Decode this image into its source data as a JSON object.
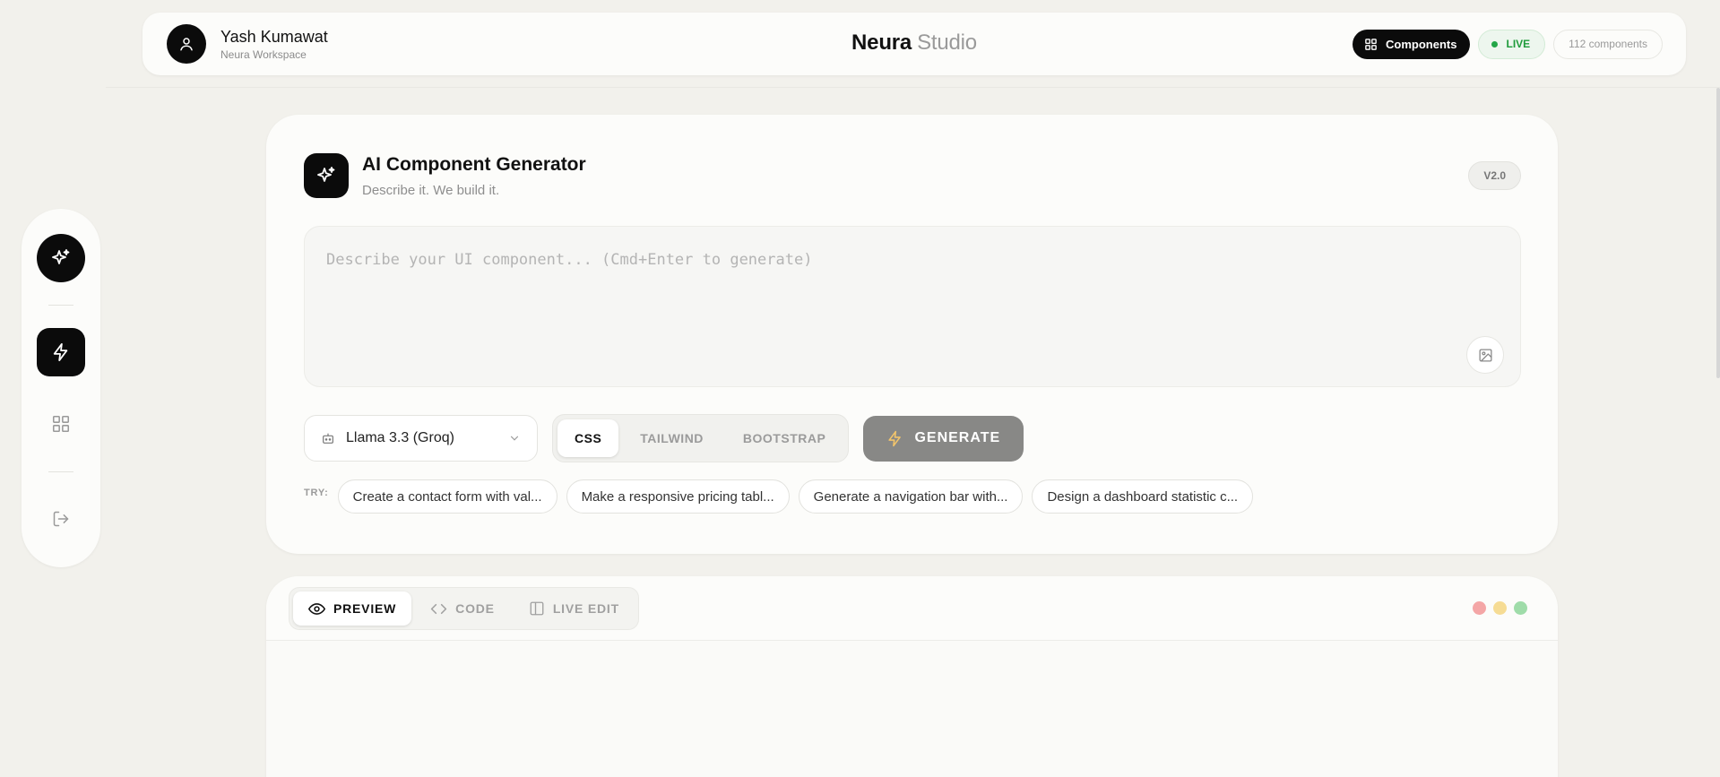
{
  "header": {
    "user_name": "Yash Kumawat",
    "workspace": "Neura Workspace",
    "brand_main": "Neura",
    "brand_sub": "Studio",
    "components_button": "Components",
    "live_label": "LIVE",
    "component_count": "112 components"
  },
  "sidebar": {
    "items": [
      {
        "name": "sparkles-icon",
        "active": true
      },
      {
        "name": "lightning-icon",
        "active": true
      },
      {
        "name": "grid-icon",
        "active": false
      },
      {
        "name": "logout-icon",
        "active": false
      }
    ]
  },
  "generator": {
    "title": "AI Component Generator",
    "subtitle": "Describe it. We build it.",
    "version": "V2.0",
    "prompt_placeholder": "Describe your UI component... (Cmd+Enter to generate)",
    "prompt_value": "",
    "model": "Llama 3.3 (Groq)",
    "frameworks": [
      "CSS",
      "TAILWIND",
      "BOOTSTRAP"
    ],
    "selected_framework": "CSS",
    "generate_label": "GENERATE",
    "try_label": "TRY:",
    "suggestions": [
      "Create a contact form with val...",
      "Make a responsive pricing tabl...",
      "Generate a navigation bar with...",
      "Design a dashboard statistic c..."
    ]
  },
  "preview": {
    "tabs": [
      "PREVIEW",
      "CODE",
      "LIVE EDIT"
    ],
    "active_tab": "PREVIEW",
    "window_dot_colors": [
      "#f4a6a6",
      "#f6dc94",
      "#9fdca9"
    ]
  },
  "colors": {
    "background": "#f2f1ec",
    "primary": "#0b0b0b",
    "live_green": "#22a647",
    "generate_disabled": "#888886"
  }
}
